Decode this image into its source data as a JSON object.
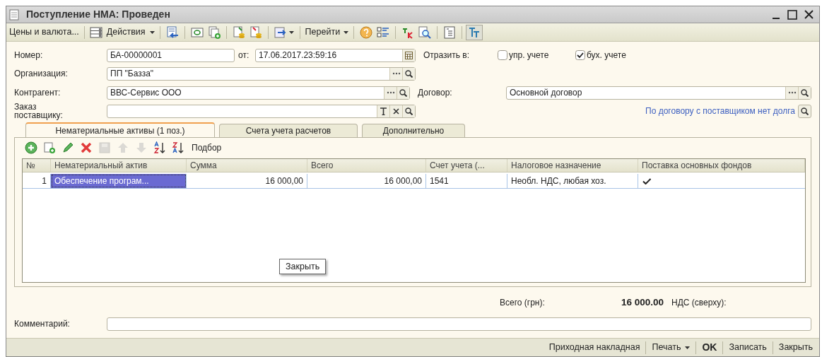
{
  "window": {
    "title": "Поступление НМА: Проведен"
  },
  "toolbar": {
    "buttons": [
      {
        "label": "Цены и валюта...",
        "dropdown": false
      },
      {
        "label": "Действия",
        "dropdown": true
      },
      {
        "label": "Перейти",
        "dropdown": true
      }
    ]
  },
  "header": {
    "number": {
      "label": "Номер:",
      "value": "БА-00000001"
    },
    "date": {
      "label": "от:",
      "value": "17.06.2017.23:59:16"
    },
    "reflect": {
      "label": "Отразить в:",
      "options": [
        {
          "label": "упр. учете",
          "checked": false
        },
        {
          "label": "бух. учете",
          "checked": true
        }
      ]
    },
    "organization": {
      "label": "Организация:",
      "value": "ПП \"Базза\""
    },
    "counterparty": {
      "label": "Контрагент:",
      "value": "ВВС-Сервис ООО"
    },
    "contract": {
      "label": "Договор:",
      "value": "Основной договор"
    },
    "supplier_order": {
      "label": "Заказ поставщику:"
    },
    "debt_link": "По договору с поставщиком нет долга"
  },
  "tabs": [
    {
      "label": "Нематериальные активы (1 поз.)",
      "selected": true
    },
    {
      "label": "Счета учета расчетов",
      "selected": false
    },
    {
      "label": "Дополнительно",
      "selected": false
    }
  ],
  "table_toolbar": {
    "pick_button": "Подбор"
  },
  "table": {
    "columns": [
      "№",
      "Нематериальный актив",
      "Сумма",
      "Всего",
      "Счет учета (...",
      "Налоговое назначение",
      "Поставка основных фондов"
    ],
    "rows": [
      {
        "cells": [
          "1",
          "Обеспечение програм...",
          "16 000,00",
          "16 000,00",
          "1541",
          "Необл. НДС, любая хоз."
        ],
        "fixed_assets_delivery": true,
        "selected": true
      }
    ]
  },
  "tooltip": "Закрыть",
  "totals": {
    "label": "Всего (грн):",
    "value": "16 000.00",
    "vat_label": "НДС (сверху):"
  },
  "comment": {
    "label": "Комментарий:"
  },
  "footer": {
    "buttons": [
      {
        "label": "Приходная накладная",
        "dropdown": false,
        "default": false
      },
      {
        "label": "Печать",
        "dropdown": true,
        "default": false
      },
      {
        "label": "OK",
        "dropdown": false,
        "default": true
      },
      {
        "label": "Записать",
        "dropdown": false,
        "default": false
      },
      {
        "label": "Закрыть",
        "dropdown": false,
        "default": false
      }
    ]
  }
}
